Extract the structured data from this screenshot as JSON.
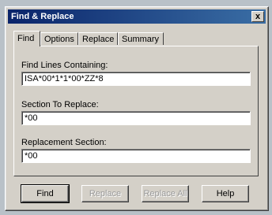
{
  "window": {
    "title": "Find & Replace",
    "close_glyph": "x"
  },
  "tabs": [
    {
      "label": "Find",
      "active": true
    },
    {
      "label": "Options",
      "active": false
    },
    {
      "label": "Replace",
      "active": false
    },
    {
      "label": "Summary",
      "active": false
    }
  ],
  "form": {
    "find_lines_label": "Find Lines Containing:",
    "find_lines_value": "ISA*00*1*1*00*ZZ*8",
    "section_label": "Section To Replace:",
    "section_value": "*00",
    "replacement_label": "Replacement Section:",
    "replacement_value": "*00"
  },
  "buttons": {
    "find": {
      "label": "Find",
      "enabled": true
    },
    "replace": {
      "label": "Replace",
      "enabled": false
    },
    "replace_all": {
      "label": "Replace All",
      "enabled": false
    },
    "help": {
      "label": "Help",
      "enabled": true
    }
  },
  "colors": {
    "title_bar_start": "#0a246a",
    "title_bar_end": "#3a6ea5",
    "dialog_face": "#d4d0c8"
  }
}
